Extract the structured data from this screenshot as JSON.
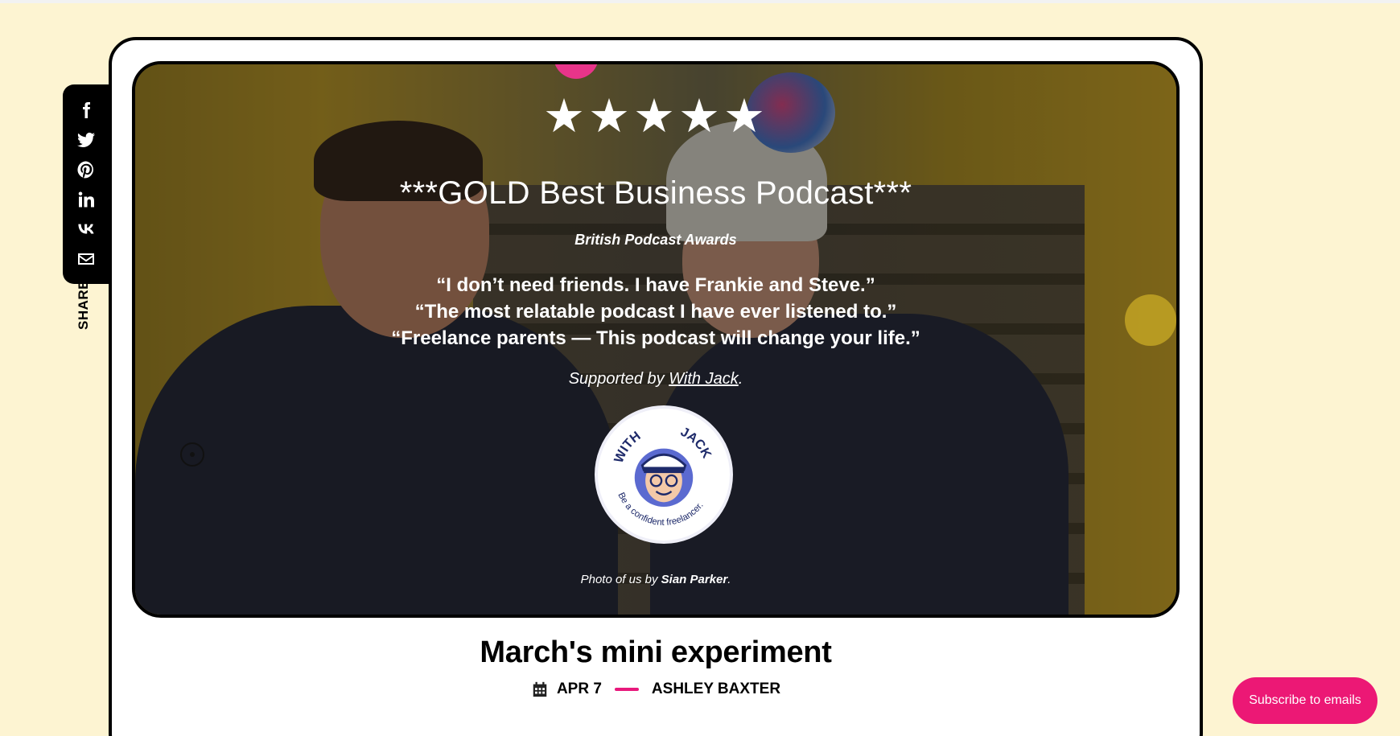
{
  "share": {
    "label": "SHARE:",
    "icons": [
      "facebook-icon",
      "twitter-icon",
      "pinterest-icon",
      "linkedin-icon",
      "vk-icon",
      "email-icon"
    ]
  },
  "hero": {
    "stars": "★★★★★",
    "award_title": "***GOLD Best Business Podcast***",
    "award_source": "British Podcast Awards",
    "quotes": [
      "“I don’t need friends. I have Frankie and Steve.”",
      "“The most relatable podcast I have ever listened to.”",
      "“Freelance parents — This podcast will change your life.”"
    ],
    "supported_prefix": "Supported by ",
    "supported_link": "With Jack",
    "supported_suffix": ".",
    "badge": {
      "top_left": "WITH",
      "top_right": "JACK",
      "tagline": "Be a confident freelancer."
    },
    "photo_credit_prefix": "Photo of us by ",
    "photo_credit_name": "Sian Parker",
    "photo_credit_suffix": "."
  },
  "post": {
    "title": "March's mini experiment",
    "date": "APR 7",
    "author": "ASHLEY BAXTER"
  },
  "subscribe_label": "Subscribe to emails",
  "colors": {
    "background": "#fdf4d2",
    "accent_pink": "#ec1875",
    "card": "#ffffff"
  }
}
